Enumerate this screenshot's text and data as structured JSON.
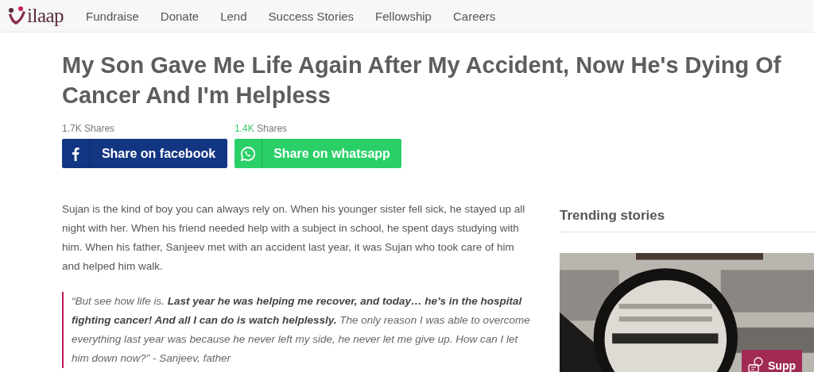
{
  "header": {
    "logo": "ilaap",
    "nav": [
      {
        "label": "Fundraise"
      },
      {
        "label": "Donate"
      },
      {
        "label": "Lend"
      },
      {
        "label": "Success Stories"
      },
      {
        "label": "Fellowship"
      },
      {
        "label": "Careers"
      }
    ]
  },
  "title": "My Son Gave Me Life Again After My Accident, Now He's Dying Of Cancer And I'm Helpless",
  "shares": [
    {
      "count": "1.7K",
      "label": "Shares",
      "button": "Share on facebook",
      "kind": "facebook"
    },
    {
      "count": "1.4K",
      "label": "Shares",
      "button": "Share on whatsapp",
      "kind": "whatsapp"
    }
  ],
  "story": {
    "paragraph": "Sujan is the kind of boy you can always rely on. When his younger sister fell sick, he stayed up all night with her.  When his friend needed help with a subject in school, he spent days studying with him. When his father, Sanjeev met with an accident last year, it was Sujan who took care of him and helped him walk.",
    "quote": "“But see how life is. **Last year he was helping me recover, and today… he’s in the hospital fighting cancer! And all I can do is watch helplessly.** The only reason I was able to overcome everything last year was because he never left my side, he never let me give up. How can I let him down now?” - Sanjeev, father"
  },
  "sidebar": {
    "title": "Trending stories"
  },
  "support_button": {
    "label": "Supp"
  }
}
